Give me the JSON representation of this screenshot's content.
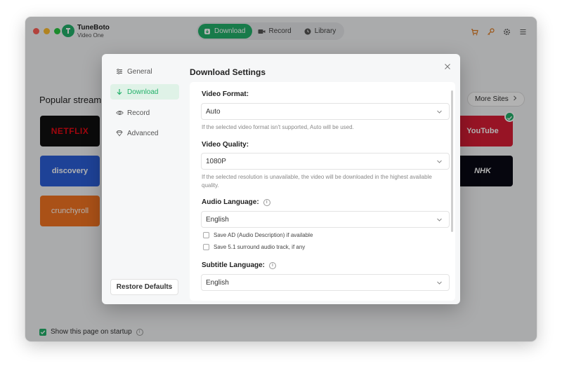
{
  "app": {
    "brand_name": "TuneBoto",
    "brand_sub": "Video One",
    "nav": [
      {
        "label": "Download",
        "active": true
      },
      {
        "label": "Record",
        "active": false
      },
      {
        "label": "Library",
        "active": false
      }
    ],
    "toolbar_icons": [
      "cart-icon",
      "key-icon",
      "gear-icon",
      "menu-icon"
    ],
    "popular_title": "Popular stream",
    "more_sites_label": "More Sites",
    "tiles": [
      "NETFLIX",
      "discovery",
      "crunchyroll",
      "YouTube",
      "NHK"
    ],
    "show_on_startup_label": "Show this page on startup",
    "accent_color": "#23b16a"
  },
  "dialog": {
    "title": "Download Settings",
    "sidebar": [
      {
        "label": "General",
        "icon": "sliders-icon",
        "active": false
      },
      {
        "label": "Download",
        "icon": "download-arrow-icon",
        "active": true
      },
      {
        "label": "Record",
        "icon": "eye-icon",
        "active": false
      },
      {
        "label": "Advanced",
        "icon": "diamond-icon",
        "active": false
      }
    ],
    "restore_label": "Restore Defaults",
    "fields": {
      "video_format": {
        "label": "Video Format:",
        "value": "Auto",
        "hint": "If the selected video format isn't supported, Auto will be used."
      },
      "video_quality": {
        "label": "Video Quality:",
        "value": "1080P",
        "hint": "If the selected resolution is unavailable, the video will be downloaded in the highest available quality."
      },
      "audio_language": {
        "label": "Audio Language:",
        "value": "English",
        "options": [
          {
            "label": "Save AD (Audio Description) if available",
            "checked": false
          },
          {
            "label": "Save 5.1 surround audio track, if any",
            "checked": false
          }
        ]
      },
      "subtitle_language": {
        "label": "Subtitle Language:",
        "value": "English"
      }
    }
  }
}
